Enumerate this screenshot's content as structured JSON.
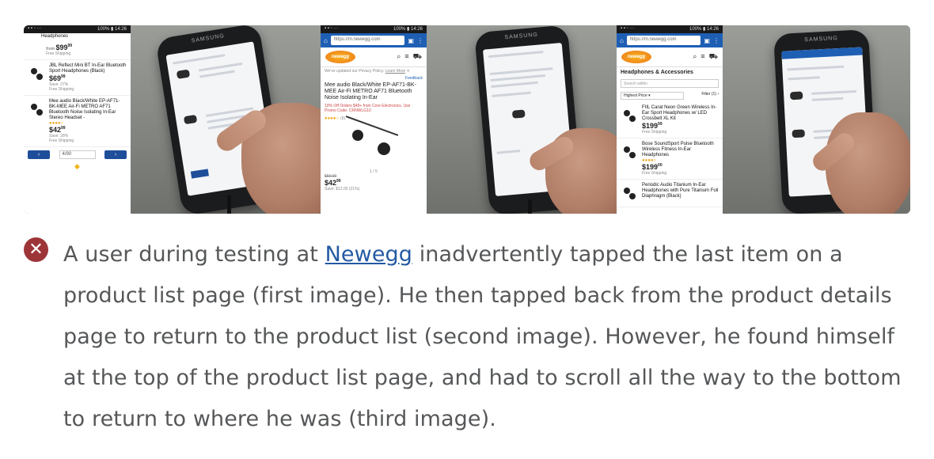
{
  "colors": {
    "error_icon": "#9d3538",
    "link": "#245aa3",
    "text": "#555759",
    "newegg_blue": "#1e5fb4"
  },
  "caption": {
    "icon": "close-icon",
    "before_link": "A user during testing at ",
    "link_text": "Newegg",
    "after_link": " inadvertently tapped the last item on a product list page (first image). He then tapped back from the product details page to return to the product list (second image). However, he found himself at the top of the product list page, and had to scroll all the way to the bottom to return to where he was (third image)."
  },
  "shot1": {
    "status_time": "100% ▮ 14:26",
    "top_partial": "Headphones",
    "items": [
      {
        "title": "",
        "price": "99",
        "cents": "99",
        "ship": "Free Shipping"
      },
      {
        "title": "JBL Reflect Mini BT In-Ear Bluetooth Sport Headphones (Black)",
        "price": "69",
        "cents": "99",
        "save": "Save: 37%",
        "ship": "Free Shipping"
      },
      {
        "title": "Mee audio Black/White EP-AF71-BK-MEE Air-Fi METRO AF71 Bluetooth Noise Isolating In-Ear Stereo Headset -",
        "price": "42",
        "cents": "99",
        "save": "Save: 28%",
        "ship": "Free Shipping"
      }
    ],
    "page_select": "4/90"
  },
  "shot2": {
    "status_time": "100% ▮ 14:26",
    "url": "https://m.newegg.com",
    "privacy": "We've updated our Privacy Policy.",
    "privacy_link": "Learn More",
    "feedback": "Feedback",
    "title": "Mee audio Black/White EP-AF71-BK-MEE Air-Fi METRO AF71 Bluetooth Noise Isolating In-Ear",
    "promo": "10% Off Orders $49+ from Core Electronics. Use Promo Code: CRNWLG10",
    "reviews": "(6)",
    "counter": "1 / 5",
    "was": "$59.99",
    "price": "42",
    "cents": "99",
    "save": "Save: $12.00 (21%)"
  },
  "shot3": {
    "status_time": "100% ▮ 14:26",
    "url": "https://m.newegg.com",
    "section": "Headphones & Accessories",
    "search_placeholder": "Search within",
    "sort": "Highest Price",
    "filter": "Filter (1)",
    "items": [
      {
        "title": "FIIL Carat Neon Green Wireless In-Ear Sport Headphones w/ LED Crossbelt XL Kit",
        "price": "199",
        "cents": "99",
        "ship": "Free Shipping"
      },
      {
        "title": "Bose SoundSport Pulse Bluetooth Wireless Fitness In-Ear Headphones",
        "price": "199",
        "cents": "00",
        "ship": "Free Shipping"
      },
      {
        "title": "Periodic Audio Titanium In-Ear Headphones with Pure Titanium Foil Diaphragm (Black)",
        "price": "",
        "cents": "",
        "ship": ""
      }
    ]
  },
  "phone_brand": "SAMSUNG"
}
